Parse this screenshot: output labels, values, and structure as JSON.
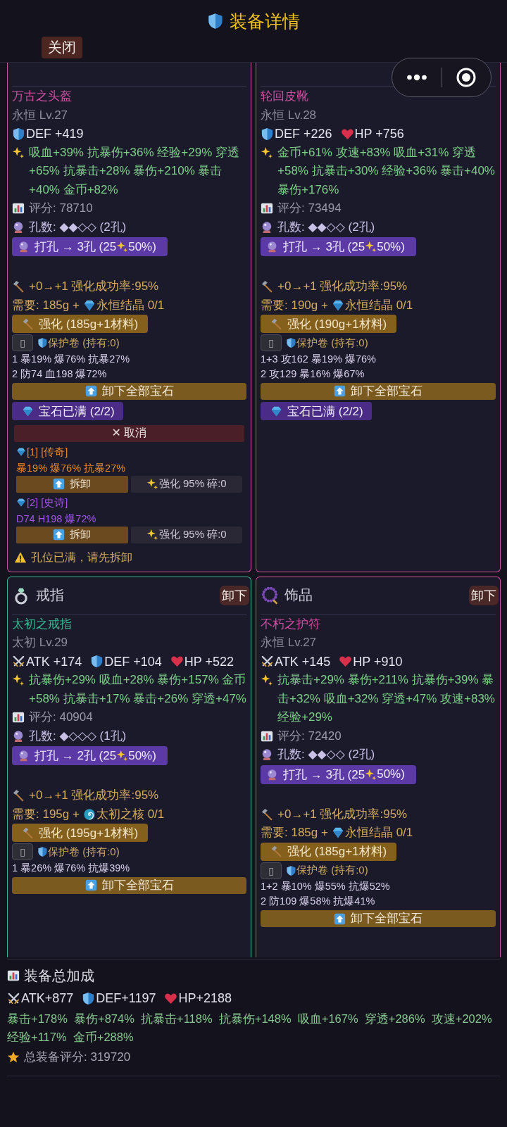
{
  "header": {
    "title": "装备详情",
    "close_button": "关闭"
  },
  "slots": [
    {
      "color": "#d24ca0",
      "name": "万古之头盔",
      "grade": "永恒 Lv.27",
      "base_stats": [
        {
          "kind": "def",
          "text": "DEF +419"
        }
      ],
      "bonus_stats": "吸血+39% 抗暴伤+36% 经验+29% 穿透+65% 抗暴击+28% 暴伤+210% 暴击+40% 金币+82%",
      "score": "评分: 78710",
      "sockets": "孔数: ◆◆◇◇ (2孔)",
      "socket_button": {
        "label": "打孔 → 3孔 (25",
        "label_end": "50%)"
      },
      "enhance": {
        "info": "+0→+1 强化成功率:95%",
        "cost": "需要: 185g +",
        "material": {
          "kind": "gem",
          "text": "永恒结晶 0/1"
        },
        "button": "强化 (185g+1材料)",
        "protect_box": "▯",
        "protect": "保护卷 (持有:0)"
      },
      "gems": [
        "1 暴19% 爆76% 抗暴27%",
        "2 防74 血198 爆72%"
      ],
      "unmount_all_button": "卸下全部宝石",
      "gem_full_button": "宝石已满 (2/2)",
      "gem_panel": {
        "cancel_button": "✕ 取消",
        "entries": [
          {
            "title": "[1] [传奇]",
            "color": "#e8892a",
            "stats": "暴19% 爆76% 抗暴27%",
            "remove_button": "拆卸",
            "upgrade_button": "强化 95% 碎:0"
          },
          {
            "title": "[2] [史诗]",
            "color": "#a455e8",
            "stats": "D74 H198 爆72%",
            "remove_button": "拆卸",
            "upgrade_button": "强化 95% 碎:0"
          }
        ],
        "warning": "孔位已满，请先拆卸"
      }
    },
    {
      "color": "#d24ca0",
      "name": "轮回皮靴",
      "grade": "永恒 Lv.28",
      "base_stats": [
        {
          "kind": "def",
          "text": "DEF +226"
        },
        {
          "kind": "hp",
          "text": "HP +756"
        }
      ],
      "bonus_stats": "金币+61% 攻速+83% 吸血+31% 穿透+58% 抗暴击+30% 经验+36% 暴击+40% 暴伤+176%",
      "score": "评分: 73494",
      "sockets": "孔数: ◆◆◇◇ (2孔)",
      "socket_button": {
        "label": "打孔 → 3孔 (25",
        "label_end": "50%)"
      },
      "enhance": {
        "info": "+0→+1 强化成功率:95%",
        "cost": "需要: 190g +",
        "material": {
          "kind": "gem",
          "text": "永恒结晶 0/1"
        },
        "button": "强化 (190g+1材料)",
        "protect_box": "▯",
        "protect": "保护卷 (持有:0)"
      },
      "gems": [
        "1+3 攻162 暴19% 爆76%",
        "2 攻129 暴16% 爆67%"
      ],
      "unmount_all_button": "卸下全部宝石",
      "gem_full_button": "宝石已满 (2/2)"
    },
    {
      "slot": {
        "kind": "ring",
        "label": "戒指",
        "unequip_button": "卸下"
      },
      "color": "#34b890",
      "name": "太初之戒指",
      "grade": "太初 Lv.29",
      "base_stats": [
        {
          "kind": "atk",
          "text": "ATK +174"
        },
        {
          "kind": "def",
          "text": "DEF +104"
        },
        {
          "kind": "hp",
          "text": "HP +522"
        }
      ],
      "bonus_stats": "抗暴伤+29% 吸血+28% 暴伤+157% 金币+58% 抗暴击+17% 暴击+26% 穿透+47%",
      "score": "评分: 40904",
      "sockets": "孔数: ◆◇◇◇ (1孔)",
      "socket_button": {
        "label": "打孔 → 2孔 (25",
        "label_end": "50%)"
      },
      "enhance": {
        "info": "+0→+1 强化成功率:95%",
        "cost": "需要: 195g +",
        "material": {
          "kind": "spiral",
          "text": "太初之核 0/1"
        },
        "button": "强化 (195g+1材料)",
        "protect_box": "▯",
        "protect": "保护卷 (持有:0)"
      },
      "gems": [
        "1 暴26% 爆76% 抗爆39%"
      ],
      "unmount_all_button": "卸下全部宝石"
    },
    {
      "slot": {
        "kind": "beads",
        "label": "饰品",
        "unequip_button": "卸下"
      },
      "color": "#d24ca0",
      "name": "不朽之护符",
      "grade": "永恒 Lv.27",
      "base_stats": [
        {
          "kind": "atk",
          "text": "ATK +145"
        },
        {
          "kind": "hp",
          "text": "HP +910"
        }
      ],
      "bonus_stats": "抗暴击+29% 暴伤+211% 抗暴伤+39% 暴击+32% 吸血+32% 穿透+47% 攻速+83% 经验+29%",
      "score": "评分: 72420",
      "sockets": "孔数: ◆◆◇◇ (2孔)",
      "socket_button": {
        "label": "打孔 → 3孔 (25",
        "label_end": "50%)"
      },
      "enhance": {
        "info": "+0→+1 强化成功率:95%",
        "cost": "需要: 185g +",
        "material": {
          "kind": "gem",
          "text": "永恒结晶 0/1"
        },
        "button": "强化 (185g+1材料)",
        "protect_box": "▯",
        "protect": "保护卷 (持有:0)"
      },
      "gems": [
        "1+2 暴10% 爆55% 抗爆52%",
        "2 防109 爆58% 抗爆41%"
      ],
      "unmount_all_button": "卸下全部宝石"
    }
  ],
  "summary": {
    "title": "装备总加成",
    "base_stats": [
      {
        "kind": "atk",
        "text": "ATK+877"
      },
      {
        "kind": "def",
        "text": "DEF+1197"
      },
      {
        "kind": "hp",
        "text": "HP+2188"
      }
    ],
    "bonus_stats": "暴击+178%  暴伤+874%  抗暴击+118%  抗暴伤+148%  吸血+167%  穿透+286%  攻速+202%  经验+117%  金币+288%",
    "score": "总装备评分: 319720"
  }
}
